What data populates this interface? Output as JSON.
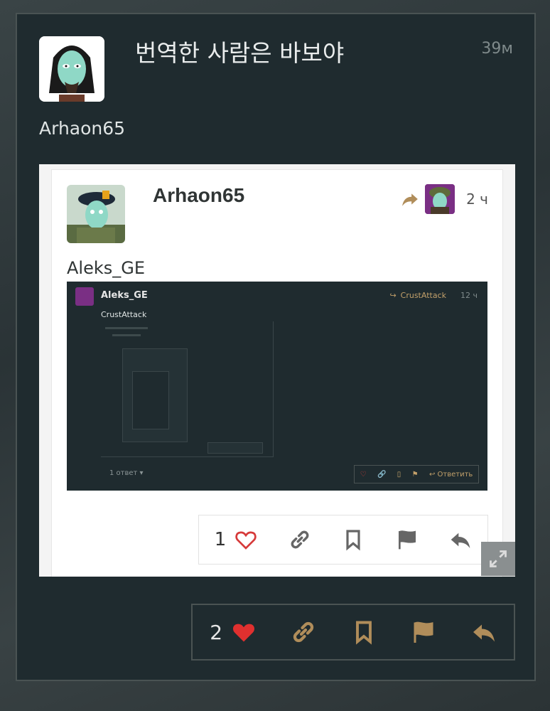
{
  "post": {
    "title": "번역한 사람은 바보야",
    "time": "39м",
    "username": "Arhaon65",
    "like_count": "2"
  },
  "quote": {
    "username": "Arhaon65",
    "time": "2 ч",
    "body_name": "Aleks_GE",
    "like_count": "1"
  },
  "screenshot": {
    "username": "Aleks_GE",
    "reply_to": "CrustAttack",
    "time": "12 ч",
    "body_name": "CrustAttack",
    "replies": "1 ответ ▾",
    "reply_label": "↩ Ответить"
  },
  "colors": {
    "accent": "#b08d5a",
    "heart": "#e0302f",
    "background": "#1f2b2f"
  }
}
